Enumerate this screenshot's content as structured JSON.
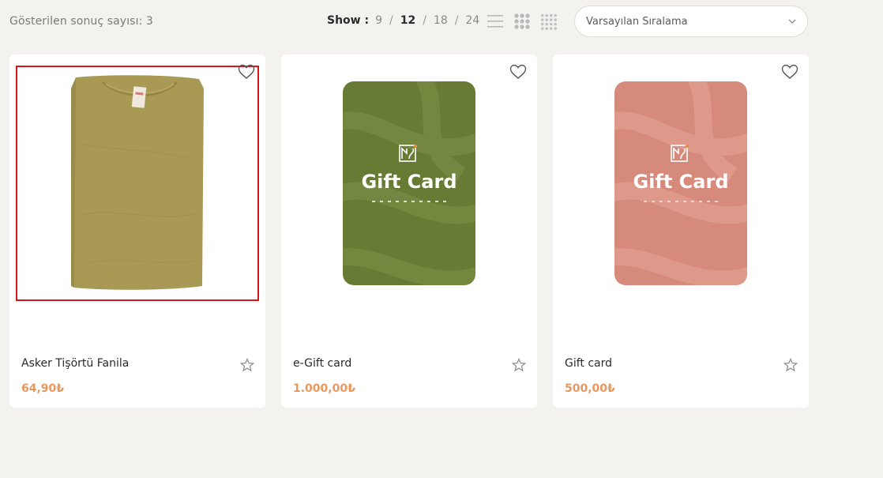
{
  "toolbar": {
    "result_count": "Gösterilen sonuç sayısı: 3",
    "show_label": "Show :",
    "per_page_options": [
      "9",
      "12",
      "18",
      "24"
    ],
    "per_page_active": "12",
    "view_icons": [
      "list-view-icon",
      "grid-3-icon",
      "grid-4-icon"
    ],
    "sort_selected": "Varsayılan Sıralama"
  },
  "products": [
    {
      "title": "Asker Tişörtü Fanila",
      "price": "64,90₺",
      "image": "olive-tshirt",
      "selected": true
    },
    {
      "title": "e-Gift card",
      "price": "1.000,00₺",
      "image": "gift-card-green",
      "card_text": "Gift Card",
      "card_color": "#687b35"
    },
    {
      "title": "Gift card",
      "price": "500,00₺",
      "image": "gift-card-pink",
      "card_text": "Gift Card",
      "card_color": "#d68a7c"
    }
  ],
  "colors": {
    "background": "#f4f2ee",
    "price": "#e6985f",
    "selection": "#d9141b",
    "tshirt": "#a89a55"
  }
}
